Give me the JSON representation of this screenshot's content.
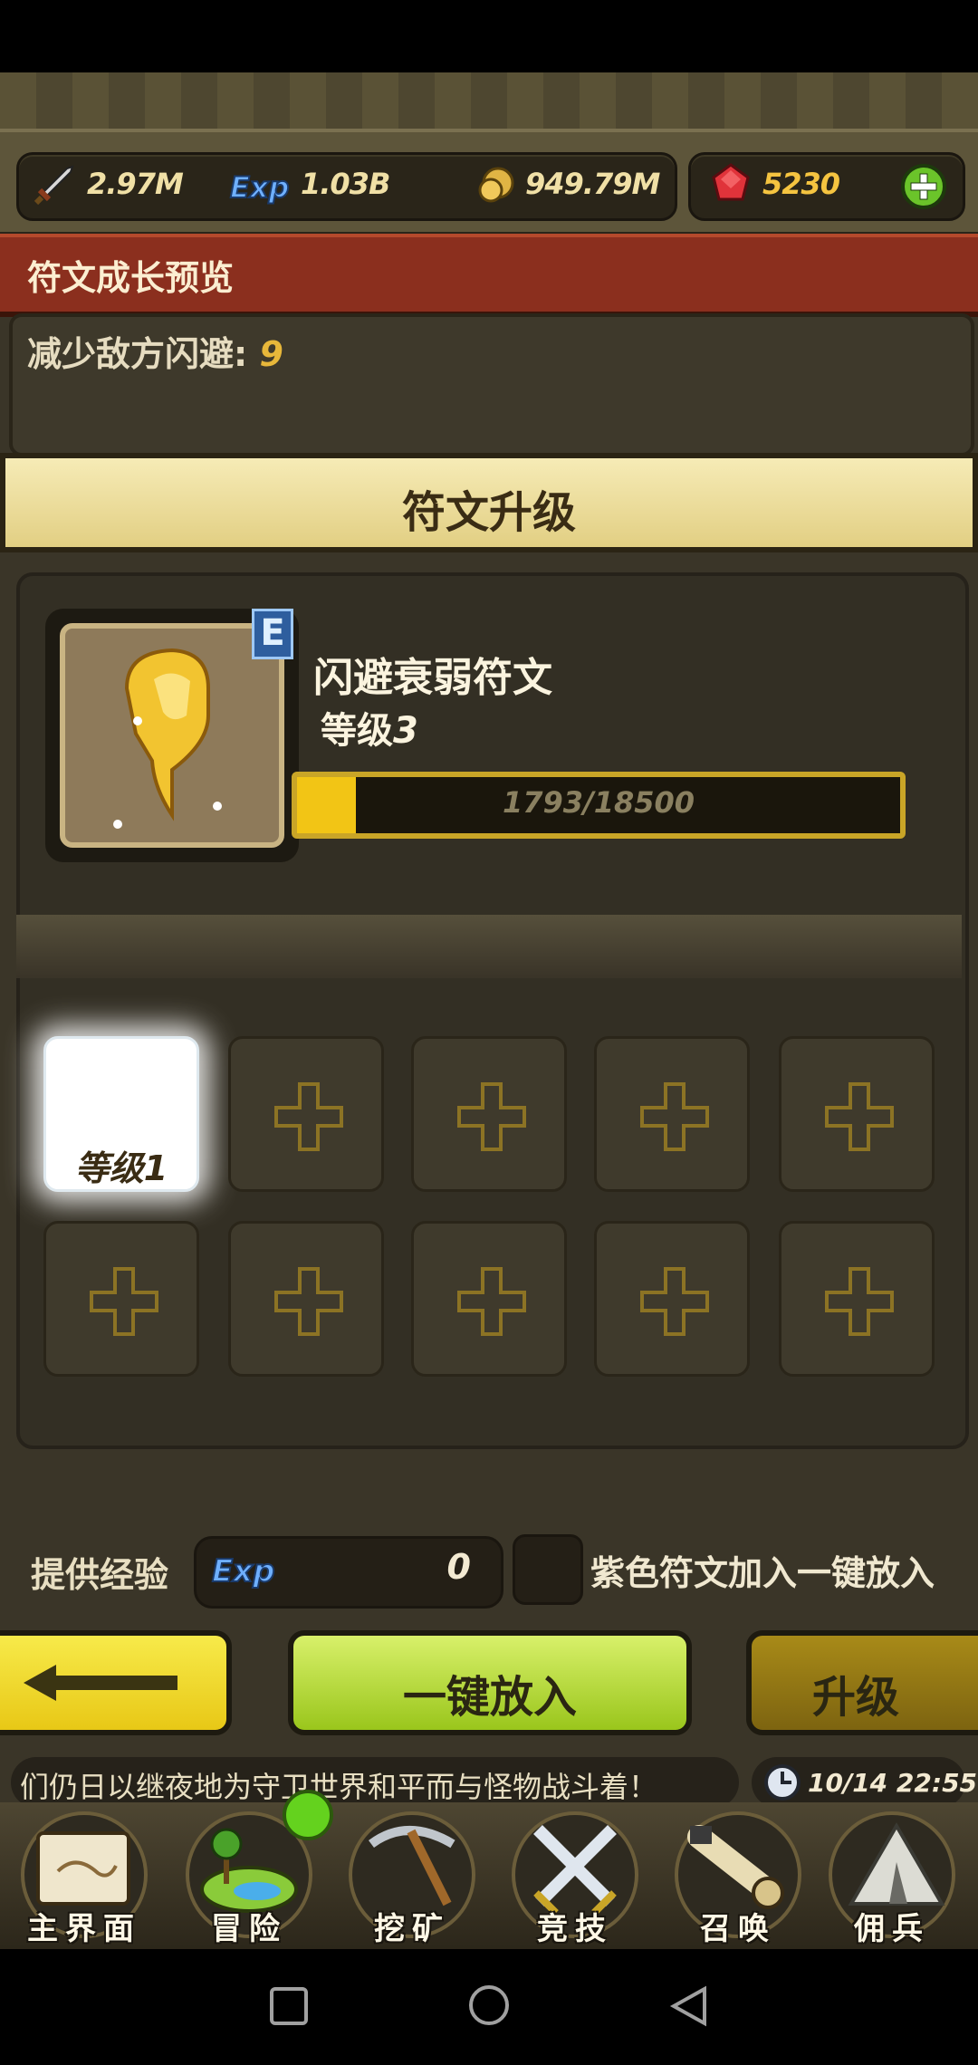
{
  "resources": {
    "attack": "2.97M",
    "exp": "1.03B",
    "gold": "949.79M",
    "gems": "5230"
  },
  "preview": {
    "title": "符文成长预览",
    "stat_label": "减少敌方闪避:",
    "stat_value": "9"
  },
  "upgrade": {
    "title": "符文升级",
    "rune_name": "闪避衰弱符文",
    "rune_grade": "E",
    "level_label": "等级",
    "level_value": "3",
    "xp_text": "1793/18500",
    "xp_progress": 0.097
  },
  "slots": {
    "first_label": "等级1"
  },
  "provide": {
    "label": "提供经验",
    "exp_icon": "Exp",
    "value": "0",
    "purple_label": "紫色符文加入一键放入"
  },
  "buttons": {
    "oneclick": "一键放入",
    "upgrade": "升级"
  },
  "ticker": {
    "text": "们仍日以继夜地为守卫世界和平而与怪物战斗着！",
    "time": "10/14 22:55"
  },
  "nav": [
    {
      "label": "主界面",
      "icon": "map-scroll-icon"
    },
    {
      "label": "冒险",
      "icon": "island-icon"
    },
    {
      "label": "挖矿",
      "icon": "pickaxe-icon"
    },
    {
      "label": "竞技",
      "icon": "crossed-swords-icon"
    },
    {
      "label": "召唤",
      "icon": "summon-scroll-icon"
    },
    {
      "label": "佣兵",
      "icon": "tent-icon"
    }
  ],
  "colors": {
    "accent_red": "#8b2f1e",
    "xp_fill": "#f2c515",
    "button_green": "#9ac61c"
  }
}
